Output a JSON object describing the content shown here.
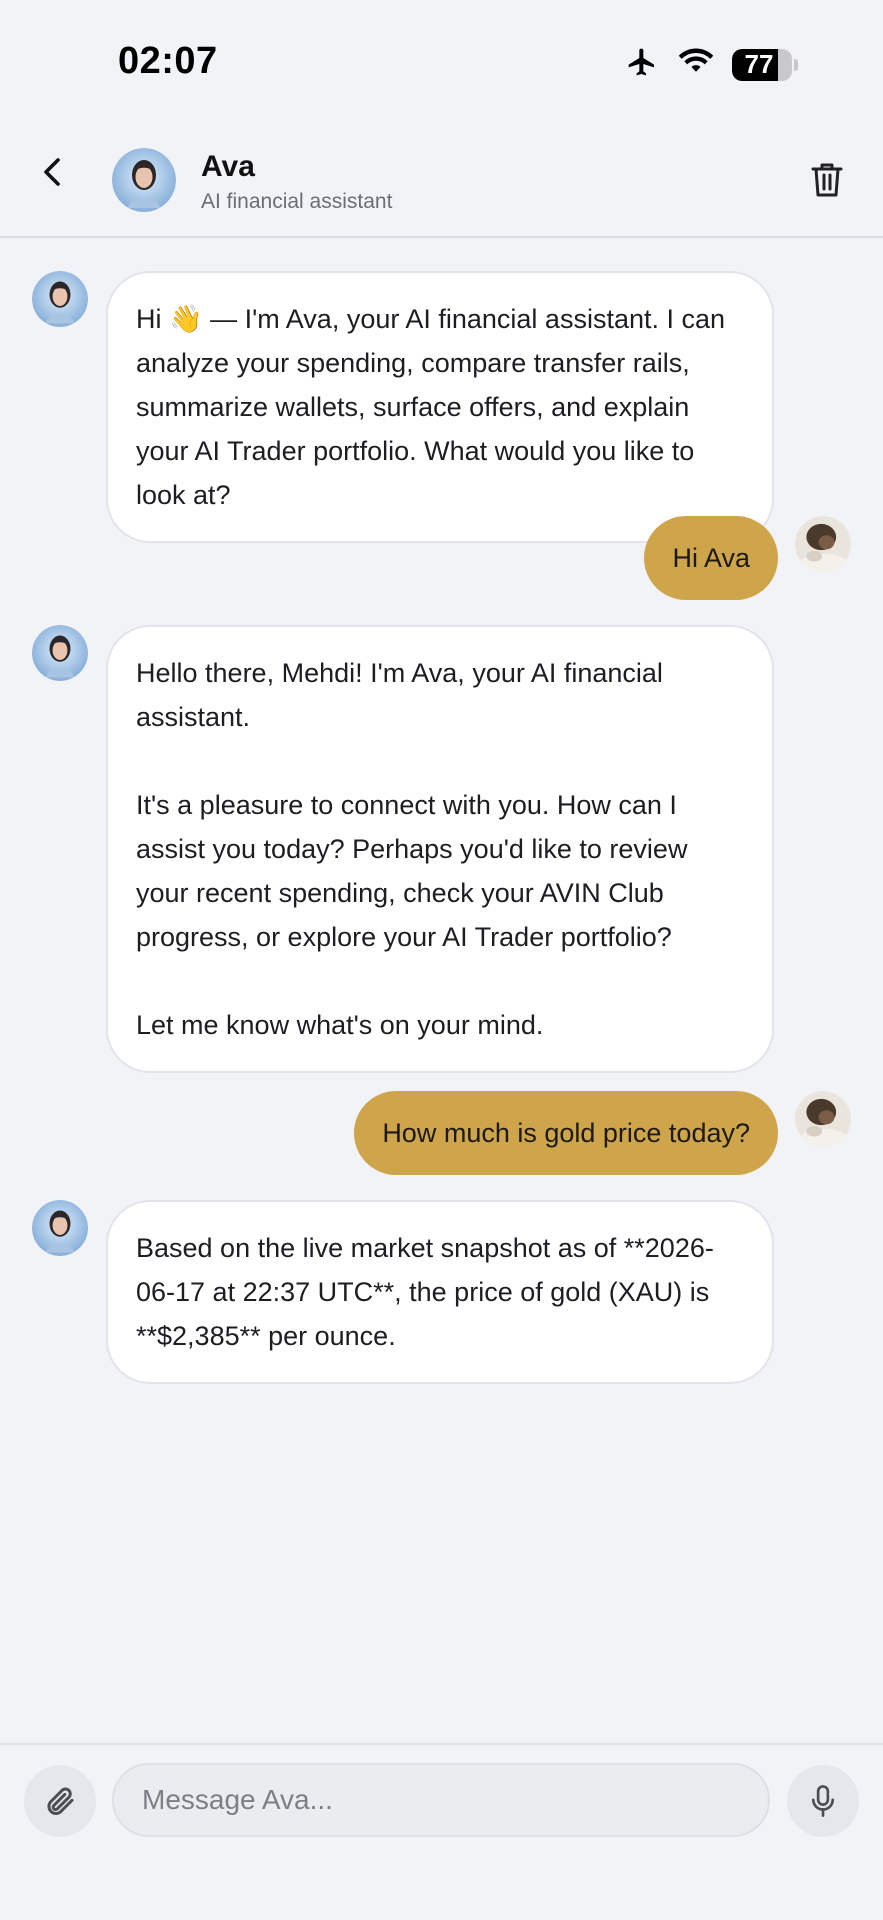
{
  "status_bar": {
    "time": "02:07",
    "battery_level": "77",
    "battery_fraction": 0.77,
    "icons": [
      "airplane-mode-icon",
      "wifi-icon",
      "battery-icon"
    ]
  },
  "header": {
    "name": "Ava",
    "subtitle": "AI financial assistant",
    "back_icon": "chevron-left-icon",
    "delete_icon": "trash-icon"
  },
  "messages": [
    {
      "sender": "ava",
      "paragraphs": [
        "Hi 👋 — I'm Ava, your AI financial assistant. I can analyze your spending, compare transfer rails, summarize wallets, surface offers, and explain your AI Trader portfolio. What would you like to look at?"
      ]
    },
    {
      "sender": "user",
      "text": "Hi Ava"
    },
    {
      "sender": "ava",
      "paragraphs": [
        "Hello there, Mehdi! I'm Ava, your AI financial assistant.",
        "It's a pleasure to connect with you. How can I assist you today? Perhaps you'd like to review your recent spending, check your AVIN Club progress, or explore your AI Trader portfolio?",
        "Let me know what's on your mind."
      ]
    },
    {
      "sender": "user",
      "text": "How much is gold price today?"
    },
    {
      "sender": "ava",
      "paragraphs": [
        "Based on the live market snapshot as of **2026-06-17 at 22:37 UTC**, the price of gold (XAU) is **$2,385** per ounce."
      ]
    }
  ],
  "composer": {
    "placeholder": "Message Ava...",
    "value": "",
    "attach_icon": "paperclip-icon",
    "mic_icon": "microphone-icon"
  },
  "colors": {
    "background": "#f2f3f7",
    "user_bubble": "#cfa54b",
    "ai_bubble": "#ffffff"
  }
}
